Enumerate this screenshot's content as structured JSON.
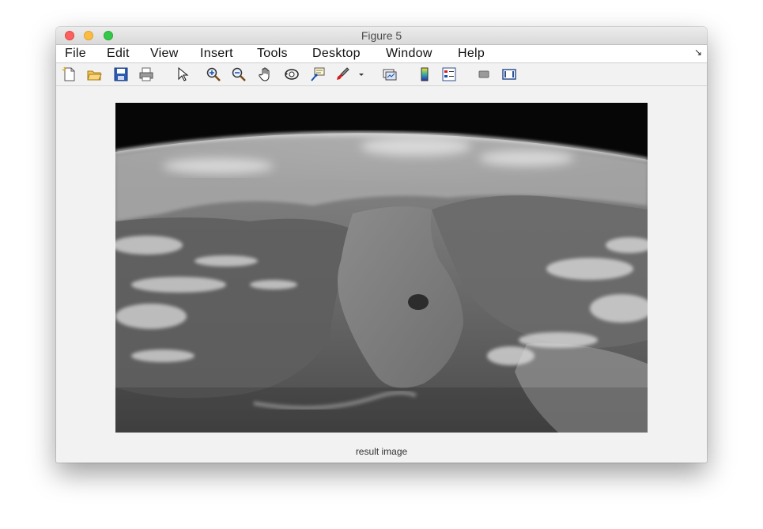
{
  "window": {
    "title": "Figure 5"
  },
  "menu": {
    "items": [
      "File",
      "Edit",
      "View",
      "Insert",
      "Tools",
      "Desktop",
      "Window",
      "Help"
    ],
    "overflow_icon": "dock-arrow-icon"
  },
  "toolbar": {
    "buttons": [
      "new-figure-icon",
      "open-file-icon",
      "save-icon",
      "print-icon",
      "pointer-icon",
      "zoom-in-icon",
      "zoom-out-icon",
      "pan-hand-icon",
      "rotate-3d-icon",
      "data-cursor-icon",
      "brush-icon",
      "brush-dropdown-icon",
      "link-plot-icon",
      "colorbar-icon",
      "legend-icon",
      "hide-plot-tools-icon",
      "show-plot-tools-icon"
    ]
  },
  "axes": {
    "image_alt": "grayscale satellite photo of Florida from orbit",
    "caption": "result image"
  },
  "colors": {
    "close": "#fc605c",
    "minimize": "#fdbc40",
    "maximize": "#34c84a"
  }
}
